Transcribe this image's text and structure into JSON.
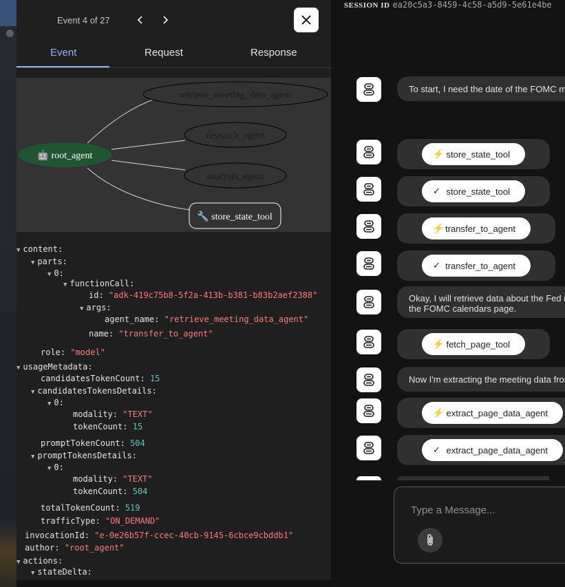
{
  "header": {
    "event_counter": "Event 4 of 27",
    "prev_icon": "chevron-left-icon",
    "next_icon": "chevron-right-icon",
    "close_icon": "close-icon"
  },
  "tabs": [
    {
      "label": "Event",
      "active": true
    },
    {
      "label": "Request",
      "active": false
    },
    {
      "label": "Response",
      "active": false
    }
  ],
  "graph": {
    "root_node": "🤖 root_agent",
    "nodes": [
      "retrieve_meeting_data_agent",
      "research_agent",
      "analysis_agent",
      "🔧 store_state_tool"
    ],
    "root_color": "#1e5631"
  },
  "json_view": {
    "content": "content:",
    "parts": "parts:",
    "idx0": "0:",
    "functionCall": "functionCall:",
    "id_key": "id:",
    "id_val": "\"adk-419c75b8-5f2a-413b-b381-b83b2aef2388\"",
    "args": "args:",
    "agent_name_key": "agent_name:",
    "agent_name_val": "\"retrieve_meeting_data_agent\"",
    "name_key": "name:",
    "name_val": "\"transfer_to_agent\"",
    "role_key": "role:",
    "role_val": "\"model\"",
    "usageMetadata": "usageMetadata:",
    "candidatesTokenCount_key": "candidatesTokenCount:",
    "candidatesTokenCount_val": "15",
    "candidatesTokensDetails": "candidatesTokensDetails:",
    "c_idx0": "0:",
    "c_modality_key": "modality:",
    "c_modality_val": "\"TEXT\"",
    "c_tokenCount_key": "tokenCount:",
    "c_tokenCount_val": "15",
    "promptTokenCount_key": "promptTokenCount:",
    "promptTokenCount_val": "504",
    "promptTokensDetails": "promptTokensDetails:",
    "p_idx0": "0:",
    "p_modality_key": "modality:",
    "p_modality_val": "\"TEXT\"",
    "p_tokenCount_key": "tokenCount:",
    "p_tokenCount_val": "504",
    "totalTokenCount_key": "totalTokenCount:",
    "totalTokenCount_val": "519",
    "trafficType_key": "trafficType:",
    "trafficType_val": "\"ON_DEMAND\"",
    "invocationId_key": "invocationId:",
    "invocationId_val": "\"e-0e26b57f-ccec-40cb-9145-6cbce9cbddb1\"",
    "author_key": "author:",
    "author_val": "\"root_agent\"",
    "actions": "actions:",
    "stateDelta": "stateDelta:"
  },
  "session": {
    "label": "SESSION ID",
    "value": "ea20c5a3-8459-4c58-a5d9-5e61e4be"
  },
  "messages": [
    {
      "kind": "text",
      "lines": [
        "To start, I need the date of the FOMC me"
      ]
    },
    {
      "kind": "tool",
      "icon": "bolt-icon",
      "glyph": "⚡",
      "label": "store_state_tool"
    },
    {
      "kind": "tool",
      "icon": "check-icon",
      "glyph": "✓",
      "label": "store_state_tool"
    },
    {
      "kind": "tool",
      "icon": "bolt-icon",
      "glyph": "⚡",
      "label": "transfer_to_agent"
    },
    {
      "kind": "tool",
      "icon": "check-icon",
      "glyph": "✓",
      "label": "transfer_to_agent"
    },
    {
      "kind": "text",
      "lines": [
        "Okay, I will retrieve data about the Fed m",
        "the FOMC calendars page."
      ]
    },
    {
      "kind": "tool",
      "icon": "bolt-icon",
      "glyph": "⚡",
      "label": "fetch_page_tool"
    },
    {
      "kind": "text",
      "lines": [
        "Now I'm extracting the meeting data fror"
      ]
    },
    {
      "kind": "tool",
      "icon": "bolt-icon",
      "glyph": "⚡",
      "label": "extract_page_data_agent"
    },
    {
      "kind": "tool",
      "icon": "check-icon",
      "glyph": "✓",
      "label": "extract_page_data_agent"
    }
  ],
  "composer": {
    "placeholder": "Type a Message...",
    "attach_icon": "paperclip-icon"
  }
}
